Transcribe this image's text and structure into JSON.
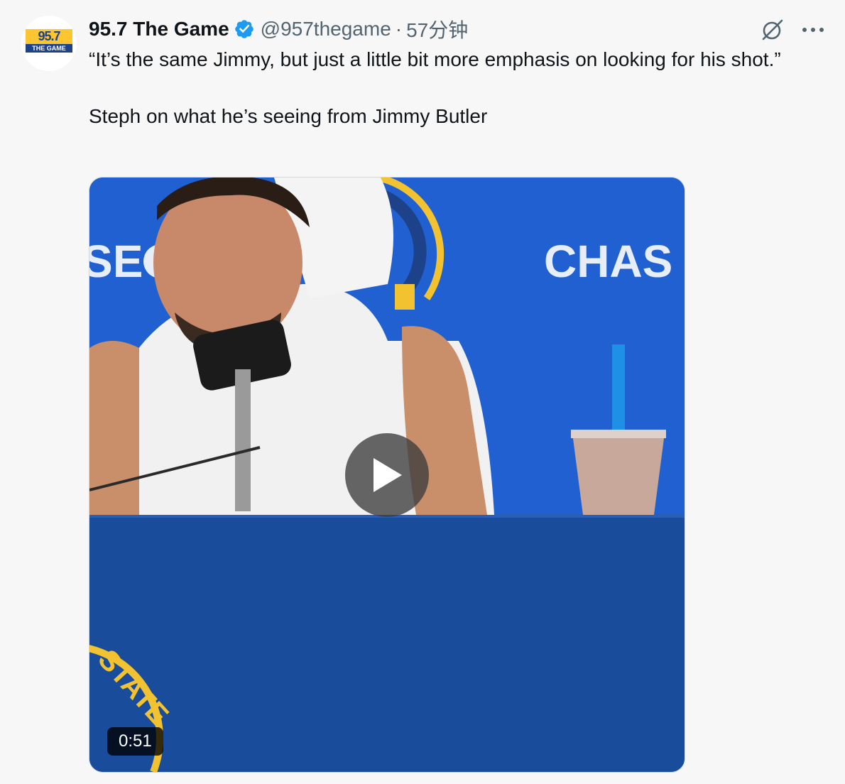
{
  "author": {
    "display_name": "95.7 The Game",
    "handle": "@957thegame",
    "separator": "·",
    "time": "57分钟",
    "avatar_logo_text": "95.7",
    "avatar_logo_sub": "THE GAME",
    "verified": true
  },
  "tweet": {
    "line1": "“It’s the same Jimmy, but just a little bit more emphasis on looking for his shot.”",
    "line2": "Steph on what he’s seeing from Jimmy Butler"
  },
  "media": {
    "duration": "0:51",
    "backdrop_text": "CHAS",
    "backdrop_text_left": "SE",
    "logo_arc_text": "STATE"
  },
  "icons": {
    "verified": "verified-badge-icon",
    "grok": "grok-icon",
    "more": "more-icon",
    "play": "play-icon"
  },
  "colors": {
    "background": "#f7f7f7",
    "primary_text": "#0f1419",
    "secondary_text": "#536471",
    "verified_blue": "#1d9bf0",
    "backdrop_blue": "#1d4fb8"
  }
}
